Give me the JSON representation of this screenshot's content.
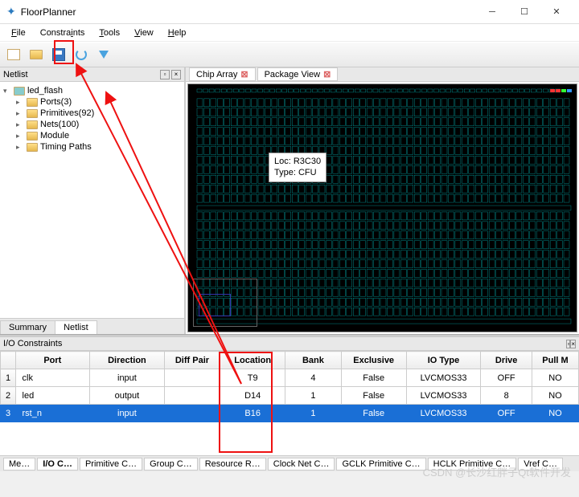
{
  "window": {
    "title": "FloorPlanner"
  },
  "menu": {
    "file": "File",
    "constraints": "Constraints",
    "tools": "Tools",
    "view": "View",
    "help": "Help"
  },
  "toolbar_icons": [
    "new",
    "open",
    "save",
    "reload",
    "down"
  ],
  "netlist_panel": {
    "title": "Netlist",
    "root": "led_flash",
    "items": [
      "Ports(3)",
      "Primitives(92)",
      "Nets(100)",
      "Module",
      "Timing Paths"
    ]
  },
  "side_tabs": {
    "summary": "Summary",
    "netlist": "Netlist"
  },
  "chip_tabs": {
    "array": "Chip Array",
    "package": "Package View"
  },
  "tooltip": {
    "line1": "Loc: R3C30",
    "line2": "Type: CFU"
  },
  "io_panel": {
    "title": "I/O Constraints"
  },
  "io_headers": [
    "Port",
    "Direction",
    "Diff Pair",
    "Location",
    "Bank",
    "Exclusive",
    "IO Type",
    "Drive",
    "Pull Mode"
  ],
  "io_rows": [
    {
      "n": "1",
      "port": "clk",
      "dir": "input",
      "diff": "",
      "loc": "T9",
      "bank": "4",
      "excl": "False",
      "iotype": "LVCMOS33",
      "drive": "OFF",
      "pull": "NONE"
    },
    {
      "n": "2",
      "port": "led",
      "dir": "output",
      "diff": "",
      "loc": "D14",
      "bank": "1",
      "excl": "False",
      "iotype": "LVCMOS33",
      "drive": "8",
      "pull": "NONE"
    },
    {
      "n": "3",
      "port": "rst_n",
      "dir": "input",
      "diff": "",
      "loc": "B16",
      "bank": "1",
      "excl": "False",
      "iotype": "LVCMOS33",
      "drive": "OFF",
      "pull": "NONE"
    }
  ],
  "footer_tabs": [
    "Me…",
    "I/O C…",
    "Primitive C…",
    "Group C…",
    "Resource R…",
    "Clock Net C…",
    "GCLK Primitive C…",
    "HCLK Primitive C…",
    "Vref C…"
  ],
  "watermark": "CSDN @长沙红胖子Qt软件开发"
}
